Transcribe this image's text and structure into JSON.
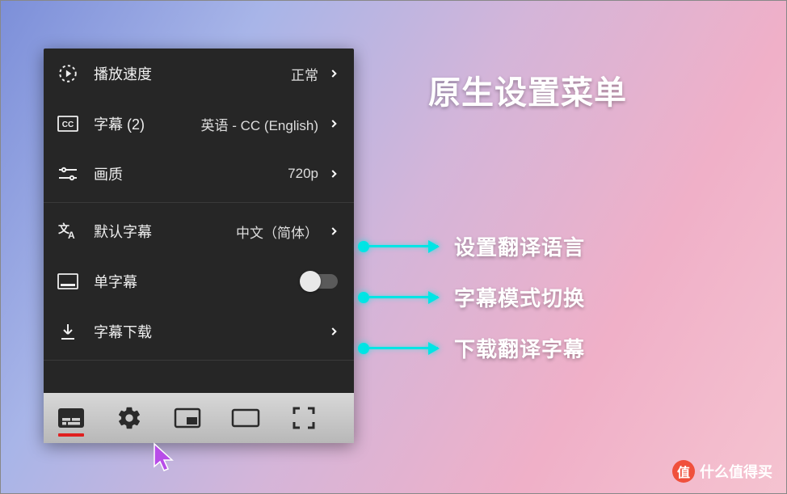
{
  "title": "原生设置菜单",
  "menu": {
    "playback_speed": {
      "label": "播放速度",
      "value": "正常"
    },
    "subtitles": {
      "label": "字幕 (2)",
      "value": "英语 - CC (English)"
    },
    "quality": {
      "label": "画质",
      "value": "720p"
    },
    "default_subtitle": {
      "label": "默认字幕",
      "value": "中文（简体）"
    },
    "single_subtitle": {
      "label": "单字幕",
      "toggle_on": false
    },
    "subtitle_download": {
      "label": "字幕下载"
    }
  },
  "annotations": {
    "set_language": "设置翻译语言",
    "mode_switch": "字幕模式切换",
    "download_sub": "下载翻译字幕"
  },
  "watermark": {
    "badge": "值",
    "text": "什么值得买"
  }
}
